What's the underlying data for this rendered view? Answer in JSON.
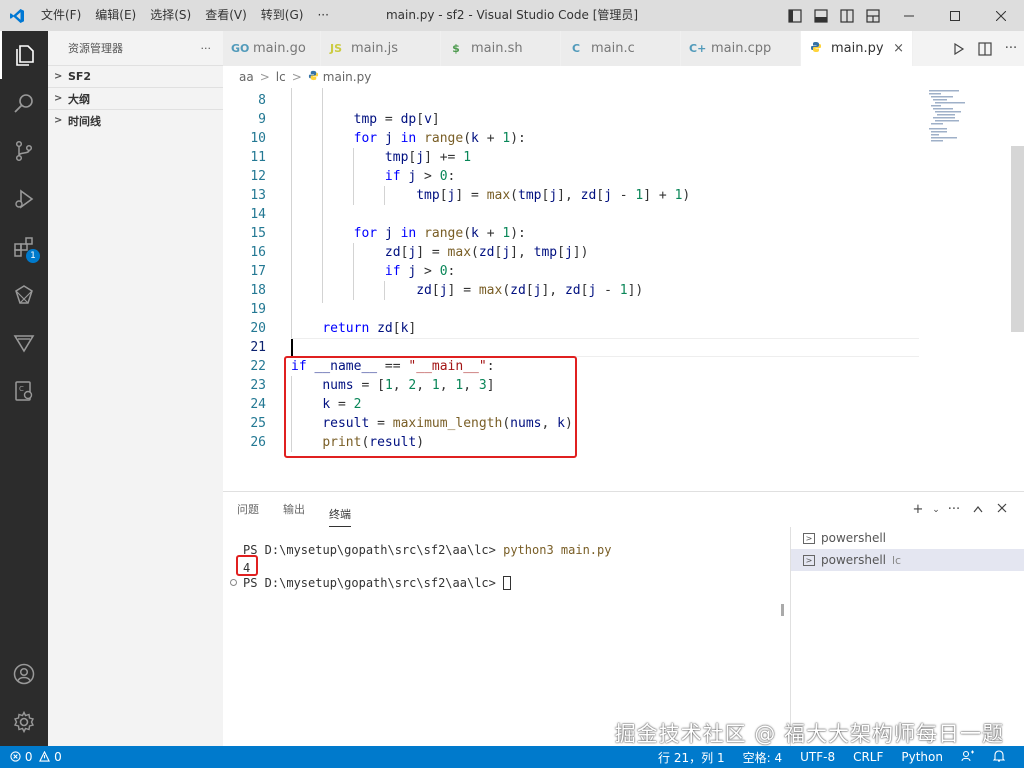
{
  "titlebar": {
    "menu": [
      "文件(F)",
      "编辑(E)",
      "选择(S)",
      "查看(V)",
      "转到(G)",
      "···"
    ],
    "title": "main.py - sf2 - Visual Studio Code [管理员]"
  },
  "sidebar": {
    "header": "资源管理器",
    "more": "···",
    "sections": [
      "SF2",
      "大纲",
      "时间线"
    ]
  },
  "activity": {
    "extensions_badge": "1"
  },
  "tabs": [
    {
      "label": "main.go",
      "icon": "GO",
      "color": "#519aba"
    },
    {
      "label": "main.js",
      "icon": "JS",
      "color": "#cbcb41"
    },
    {
      "label": "main.sh",
      "icon": "$",
      "color": "#4d5a5e"
    },
    {
      "label": "main.c",
      "icon": "C",
      "color": "#519aba"
    },
    {
      "label": "main.cpp",
      "icon": "C+",
      "color": "#519aba"
    },
    {
      "label": "main.py",
      "icon": "py",
      "color": "#3572a5"
    }
  ],
  "tab_close": "×",
  "breadcrumb": [
    "aa",
    "lc",
    "main.py"
  ],
  "editor": {
    "line_numbers": [
      "8",
      "9",
      "10",
      "11",
      "12",
      "13",
      "14",
      "15",
      "16",
      "17",
      "18",
      "19",
      "20",
      "21",
      "22",
      "23",
      "24",
      "25",
      "26"
    ]
  },
  "panel": {
    "tabs": [
      "问题",
      "输出",
      "终端"
    ],
    "terminal": {
      "prompt1": "PS D:\\mysetup\\gopath\\src\\sf2\\aa\\lc> ",
      "command": "python3 main.py",
      "output": "4",
      "prompt2": "PS D:\\mysetup\\gopath\\src\\sf2\\aa\\lc> "
    },
    "terminals": [
      {
        "label": "powershell",
        "sub": ""
      },
      {
        "label": "powershell",
        "sub": "lc"
      }
    ]
  },
  "watermark": "掘金技术社区 @ 福大大架构师每日一题",
  "statusbar": {
    "errors": "0",
    "warnings": "0",
    "position": "行 21，列 1",
    "spaces": "空格: 4",
    "encoding": "UTF-8",
    "eol": "CRLF",
    "language": "Python"
  },
  "colors": {
    "accent": "#007acc",
    "highlight": "#e02020"
  }
}
